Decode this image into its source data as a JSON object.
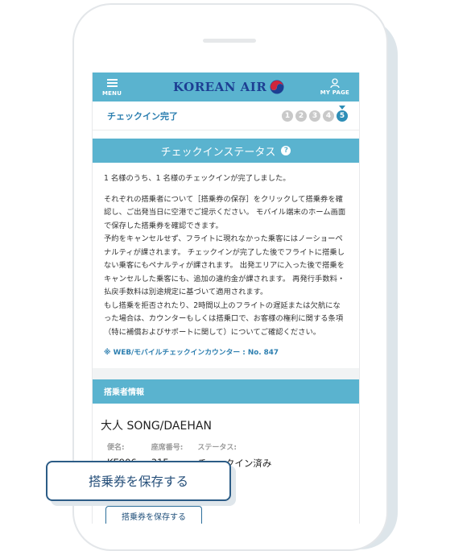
{
  "header": {
    "menu_label": "MENU",
    "logo_text": "KOREAN AIR",
    "mypage_label": "MY PAGE",
    "menu_icon": "hamburger-menu-icon",
    "mypage_icon": "user-icon",
    "color": "#5ab3cf"
  },
  "progress": {
    "title": "チェックイン完了",
    "steps": [
      "1",
      "2",
      "3",
      "4",
      "5"
    ],
    "active_step": 5
  },
  "status": {
    "title": "チェックインステータス",
    "help_icon": "?"
  },
  "body": {
    "summary": "1 名様のうち、1 名様のチェックインが完了しました。",
    "paragraph": "それぞれの搭乗者について［搭乗券の保存］をクリックして搭乗券を確認し、ご出発当日に空港でご提示ください。 モバイル端末のホーム画面で保存した搭乗券を確認できます。",
    "paragraph2": "予約をキャンセルせず、フライトに現れなかった乗客にはノーショーペナルティが課されます。 チェックインが完了した後でフライトに搭乗しない乗客にもペナルティが課されます。 出発エリアに入った後で搭乗をキャンセルした乗客にも、追加の違約金が課されます。 再発行手数料・払戻手数料は別途規定に基づいて適用されます。",
    "paragraph3": "もし搭乗を拒否されたり、2時間以上のフライトの遅延または欠航になった場合は、カウンターもしくは搭乗口で、お客様の権利に関する条項（特に補償およびサポートに関して）についてご確認ください。",
    "counter": "※ WEB/モバイルチェックインカウンター : No. 847"
  },
  "passenger": {
    "section_title": "搭乗者情報",
    "name": "大人 SONG/DAEHAN",
    "flight_label": "便名:",
    "flight": "KE906",
    "seat_label": "座席番号:",
    "seat": "31F",
    "status_label": "ステータス:",
    "status": "チェックイン済み",
    "save_button": "搭乗券を保存する"
  },
  "callout": {
    "save_button": "搭乗券を保存する"
  }
}
